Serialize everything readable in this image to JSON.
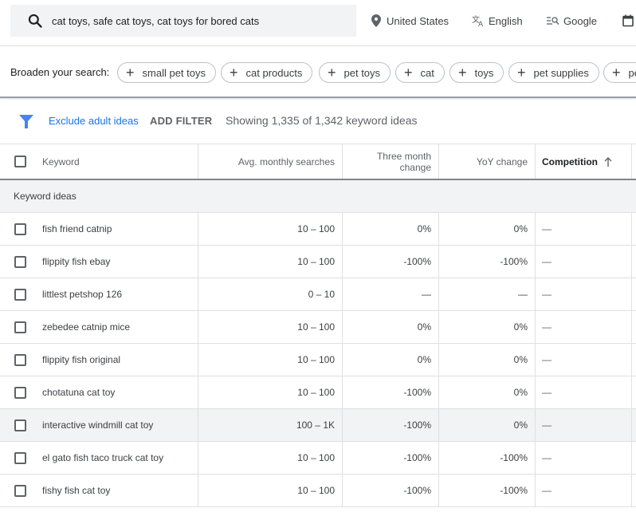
{
  "topbar": {
    "search_query": "cat toys, safe cat toys, cat toys for bored cats",
    "location": "United States",
    "language": "English",
    "network": "Google",
    "icons": {
      "search": "search-icon",
      "location": "location-pin-icon",
      "language": "translate-icon",
      "network": "search-network-icon",
      "date": "calendar-icon"
    }
  },
  "broaden": {
    "label": "Broaden your search:",
    "chips": [
      "small pet toys",
      "cat products",
      "pet toys",
      "cat",
      "toys",
      "pet supplies",
      "pet"
    ],
    "chip_icon": "+"
  },
  "filterbar": {
    "exclude_label": "Exclude adult ideas",
    "add_filter_label": "ADD FILTER",
    "showing_text": "Showing 1,335 of 1,342 keyword ideas",
    "accent_color": "#1a73e8"
  },
  "table": {
    "headers": {
      "keyword": "Keyword",
      "avg_monthly": "Avg. monthly searches",
      "three_month": "Three month change",
      "yoy": "YoY change",
      "competition": "Competition"
    },
    "sort": {
      "column": "competition",
      "direction": "ascending"
    },
    "group_label": "Keyword ideas",
    "rows": [
      {
        "keyword": "fish friend catnip",
        "avg": "10 – 100",
        "three": "0%",
        "yoy": "0%",
        "comp": "—"
      },
      {
        "keyword": "flippity fish ebay",
        "avg": "10 – 100",
        "three": "-100%",
        "yoy": "-100%",
        "comp": "—"
      },
      {
        "keyword": "littlest petshop 126",
        "avg": "0 – 10",
        "three": "—",
        "yoy": "—",
        "comp": "—"
      },
      {
        "keyword": "zebedee catnip mice",
        "avg": "10 – 100",
        "three": "0%",
        "yoy": "0%",
        "comp": "—"
      },
      {
        "keyword": "flippity fish original",
        "avg": "10 – 100",
        "three": "0%",
        "yoy": "0%",
        "comp": "—"
      },
      {
        "keyword": "chotatuna cat toy",
        "avg": "10 – 100",
        "three": "-100%",
        "yoy": "0%",
        "comp": "—"
      },
      {
        "keyword": "interactive windmill cat toy",
        "avg": "100 – 1K",
        "three": "-100%",
        "yoy": "0%",
        "comp": "—",
        "hovered": true
      },
      {
        "keyword": "el gato fish taco truck cat toy",
        "avg": "10 – 100",
        "three": "-100%",
        "yoy": "-100%",
        "comp": "—"
      },
      {
        "keyword": "fishy fish cat toy",
        "avg": "10 – 100",
        "three": "-100%",
        "yoy": "-100%",
        "comp": "—"
      }
    ]
  }
}
